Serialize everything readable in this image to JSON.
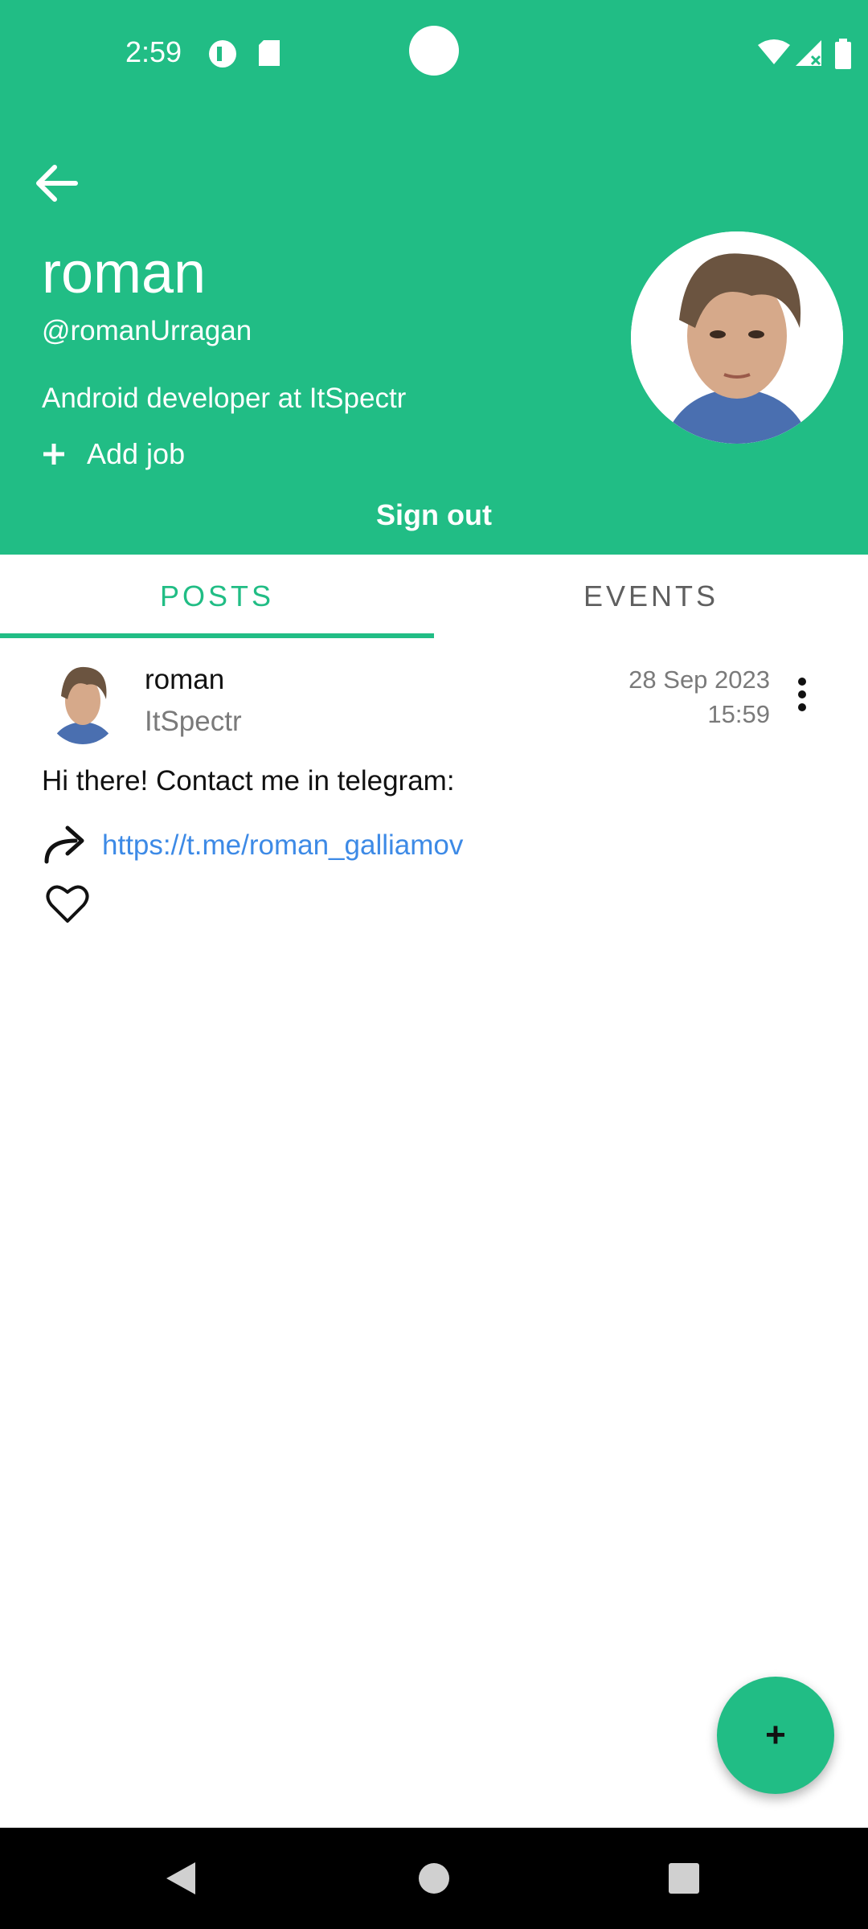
{
  "status_bar": {
    "time": "2:59"
  },
  "profile": {
    "name": "roman",
    "handle": "@romanUrragan",
    "job": "Android developer at ItSpectr",
    "add_job_label": "Add job",
    "sign_out_label": "Sign out"
  },
  "tabs": [
    {
      "label": "POSTS",
      "selected": true
    },
    {
      "label": "EVENTS",
      "selected": false
    }
  ],
  "post": {
    "author": "roman",
    "company": "ItSpectr",
    "date": "28 Sep 2023",
    "time": "15:59",
    "content": "Hi there! Contact me in telegram:",
    "link": "https://t.me/roman_galliamov"
  },
  "fab": {
    "label": "+"
  },
  "colors": {
    "accent": "#21bd85",
    "link": "#3d8ae6"
  }
}
